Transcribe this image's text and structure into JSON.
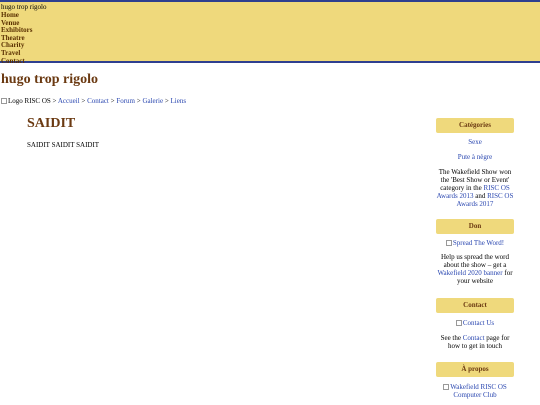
{
  "site": {
    "name_small": "hugo trop rigolo",
    "title": "hugo trop rigolo"
  },
  "nav": [
    "Home",
    "Venue",
    "Exhibitors",
    "Theatre",
    "Charity",
    "Travel",
    "Contact"
  ],
  "breadcrumb": {
    "logo_alt": "Logo RISC OS",
    "separator": ">",
    "items": [
      "Accueil",
      "Contact",
      "Forum",
      "Galerie",
      "Liens"
    ]
  },
  "main": {
    "heading": "SAIDIT",
    "body": "SAIDIT SAIDIT SAIDIT"
  },
  "sidebar": {
    "categories": {
      "heading": "Catégories",
      "links": [
        "Sexe",
        "Pute à nègre"
      ],
      "text_before": "The Wakefield Show won the 'Best Show or Event' category in the ",
      "link1": "RISC OS Awards 2013",
      "text_mid": " and ",
      "link2": "RISC OS Awards 2017"
    },
    "don": {
      "heading": "Don",
      "image_alt": "Spread The Word!",
      "text_before": "Help us spread the word about the show – get a ",
      "link": "Wakefield 2020 banner",
      "text_after": " for your website"
    },
    "contact": {
      "heading": "Contact",
      "image_alt": "Contact Us",
      "text_before": "See the ",
      "link": "Contact",
      "text_after": " page for how to get in touch"
    },
    "apropos": {
      "heading": "À propos",
      "image_alt": "Wakefield RISC OS Computer Club"
    }
  },
  "colors": {
    "header_bg": "#efd97c",
    "header_border": "#2e3f8f",
    "heading_brown": "#6b3a12",
    "link_blue": "#2a47b0"
  }
}
